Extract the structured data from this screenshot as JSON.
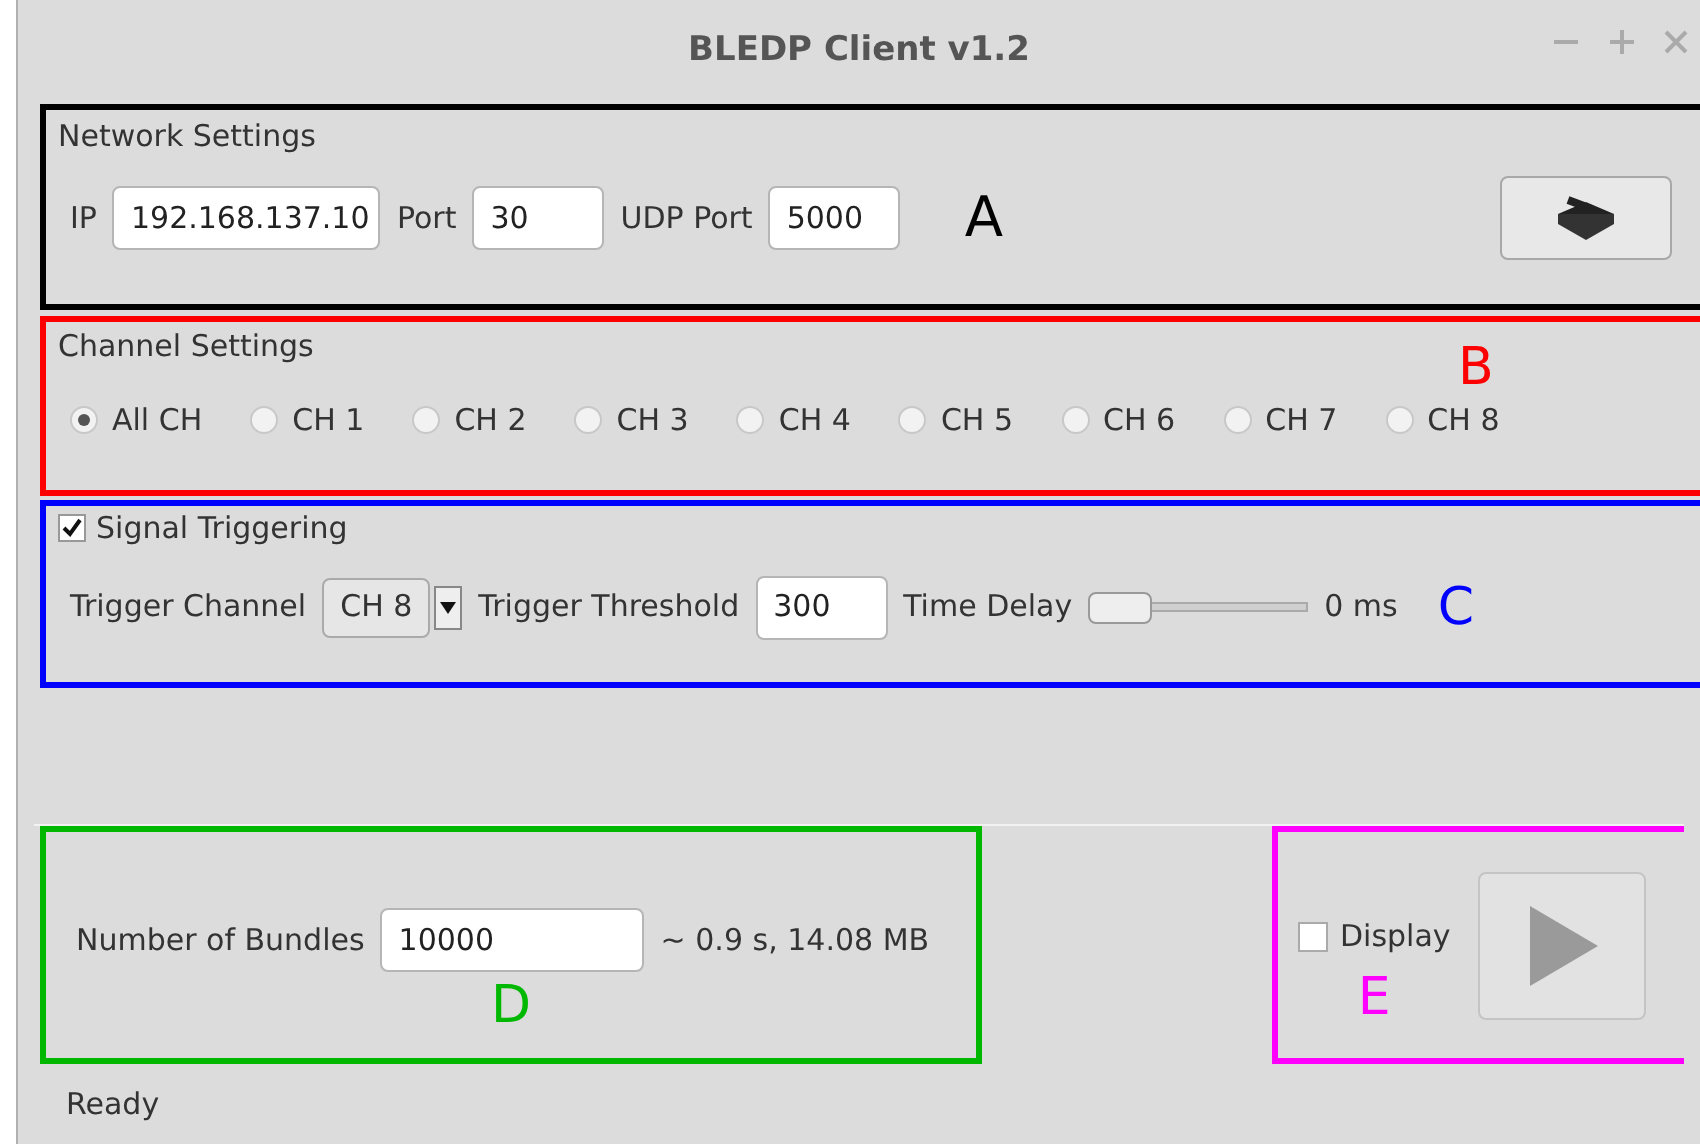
{
  "window": {
    "title": "BLEDP Client v1.2"
  },
  "network_settings": {
    "title": "Network Settings",
    "ip_label": "IP",
    "ip_value": "192.168.137.10",
    "port_label": "Port",
    "port_value": "30",
    "udp_port_label": "UDP Port",
    "udp_port_value": "5000",
    "annotation": {
      "label": "A",
      "color": "#000000"
    }
  },
  "channel_settings": {
    "title": "Channel Settings",
    "annotation": {
      "label": "B",
      "color": "#ff0000"
    },
    "channels": [
      {
        "label": "All CH",
        "selected": true
      },
      {
        "label": "CH 1",
        "selected": false
      },
      {
        "label": "CH 2",
        "selected": false
      },
      {
        "label": "CH 3",
        "selected": false
      },
      {
        "label": "CH 4",
        "selected": false
      },
      {
        "label": "CH 5",
        "selected": false
      },
      {
        "label": "CH 6",
        "selected": false
      },
      {
        "label": "CH 7",
        "selected": false
      },
      {
        "label": "CH 8",
        "selected": false
      }
    ]
  },
  "signal_triggering": {
    "title": "Signal Triggering",
    "checked": true,
    "trigger_channel_label": "Trigger Channel",
    "trigger_channel_value": "CH 8",
    "threshold_label": "Trigger Threshold",
    "threshold_value": "300",
    "time_delay_label": "Time Delay",
    "time_delay": {
      "level": 0
    },
    "time_delay_reading": "0 ms",
    "annotation": {
      "label": "C",
      "color": "#0000ff"
    }
  },
  "bundles": {
    "label": "Number of Bundles",
    "value": "10000",
    "estimate": "~ 0.9 s, 14.08 MB",
    "annotation": {
      "label": "D",
      "color": "#00b800"
    }
  },
  "display": {
    "label": "Display",
    "checked": false,
    "annotation": {
      "label": "E",
      "color": "#ff00ff"
    }
  },
  "status_bar": {
    "text": "Ready"
  }
}
